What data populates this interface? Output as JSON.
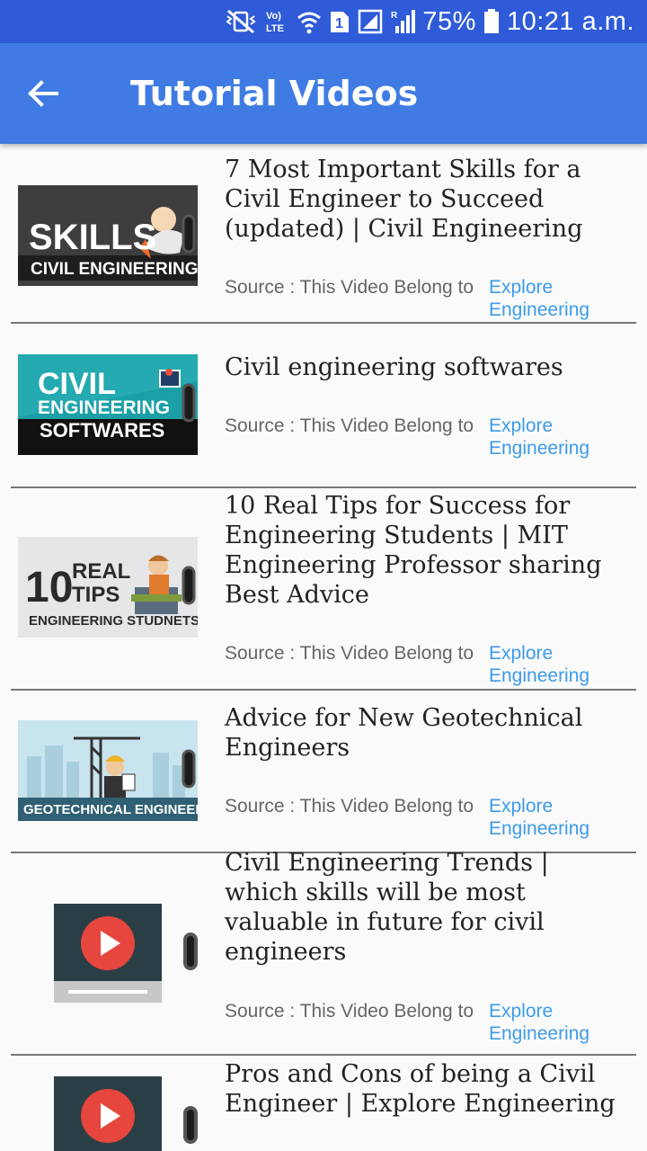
{
  "status_bar": {
    "lte": "Vo) LTE",
    "sim": "1",
    "roaming": "R",
    "battery_percent": "75%",
    "time": "10:21 a.m.",
    "icons": [
      "mute-vibrate-icon",
      "volte-icon",
      "wifi-icon",
      "sim-icon",
      "signal-icon",
      "battery-icon"
    ]
  },
  "app_bar": {
    "title": "Tutorial Videos",
    "back_icon": "arrow-left-icon",
    "color": "#3f7be3"
  },
  "source_prefix": "Source : This Video Belong to",
  "source_link": "Explore Engineering",
  "videos": [
    {
      "title": "7 Most Important Skills for a Civil Engineer to Succeed (updated) | Civil Engineering",
      "thumb_line1": "SKILLS",
      "thumb_line2": "CIVIL ENGINEERING"
    },
    {
      "title": "Civil engineering softwares",
      "thumb_line1": "CIVIL",
      "thumb_line2": "ENGINEERING",
      "thumb_line3": "SOFTWARES"
    },
    {
      "title": "10 Real Tips for Success for Engineering Students | MIT Engineering Professor sharing Best Advice",
      "thumb_line1": "10",
      "thumb_line2": "REAL",
      "thumb_line3": "TIPS",
      "thumb_line4": "ENGINEERING STUDNETS"
    },
    {
      "title": "Advice for New Geotechnical Engineers",
      "thumb_line1": "GEOTECHNICAL ENGINEERS"
    },
    {
      "title": "Civil Engineering Trends | which skills will be most valuable in future for civil engineers"
    },
    {
      "title": "Pros and Cons of being a Civil Engineer | Explore Engineering"
    }
  ]
}
